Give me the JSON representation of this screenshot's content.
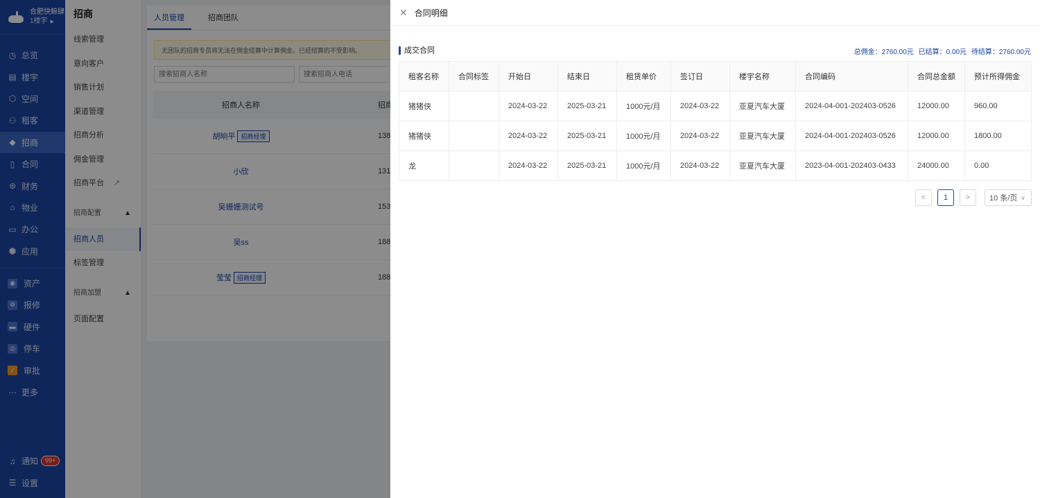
{
  "nav": {
    "brand_name": "合肥快鲸肆",
    "brand_sub": "1楼宇",
    "items": [
      {
        "label": "总览",
        "icon": "dashboard-icon"
      },
      {
        "label": "楼宇",
        "icon": "building-icon"
      },
      {
        "label": "空间",
        "icon": "cube-icon"
      },
      {
        "label": "租客",
        "icon": "tenant-icon"
      },
      {
        "label": "招商",
        "icon": "tag-icon"
      },
      {
        "label": "合同",
        "icon": "document-icon"
      },
      {
        "label": "财务",
        "icon": "finance-icon"
      },
      {
        "label": "物业",
        "icon": "home-icon"
      },
      {
        "label": "办公",
        "icon": "monitor-icon"
      },
      {
        "label": "应用",
        "icon": "app-icon"
      }
    ],
    "ext_items": [
      {
        "label": "资产",
        "icon": "asset-icon"
      },
      {
        "label": "报修",
        "icon": "repair-icon"
      },
      {
        "label": "硬件",
        "icon": "hardware-icon"
      },
      {
        "label": "停车",
        "icon": "parking-icon"
      },
      {
        "label": "审批",
        "icon": "approval-icon"
      },
      {
        "label": "更多",
        "icon": "more-icon"
      }
    ],
    "notify_label": "通知",
    "notify_count": "99+",
    "settings_label": "设置"
  },
  "submenu": {
    "title": "招商",
    "items": [
      "线索管理",
      "意向客户",
      "销售计划",
      "渠道管理",
      "招商分析",
      "佣金管理",
      "招商平台"
    ],
    "group1": "招商配置",
    "group1_items": [
      "招商人员",
      "标签管理"
    ],
    "group2": "招商加盟",
    "group2_items": [
      "页面配置"
    ]
  },
  "main": {
    "tabs": [
      "人员管理",
      "招商团队"
    ],
    "notice": "无团队的招商专员将无法在佣金结算中计算佣金。已经结算的不受影响。",
    "search_name_placeholder": "搜索招商人名称",
    "search_phone_placeholder": "搜索招商人电话",
    "col_name": "招商人名称",
    "col_phone": "招商",
    "rows": [
      {
        "name": "胡晌平",
        "tag": "招商经理",
        "phone": "138"
      },
      {
        "name": "小欣",
        "tag": "",
        "phone": "131"
      },
      {
        "name": "吴姗姗测试号",
        "tag": "",
        "phone": "153"
      },
      {
        "name": "吴ss",
        "tag": "",
        "phone": "188"
      },
      {
        "name": "莹莹",
        "tag": "招商经理",
        "phone": "188"
      }
    ]
  },
  "drawer": {
    "title": "合同明细",
    "section_title": "成交合同",
    "summary": {
      "total": "总佣金：2760.00元",
      "settled": "已结算：0.00元",
      "pending": "待结算：2760.00元"
    },
    "columns": [
      "租客名称",
      "合同标签",
      "开始日",
      "结束日",
      "租赁单价",
      "签订日",
      "楼宇名称",
      "合同编码",
      "合同总金额",
      "预计所得佣金"
    ],
    "rows": [
      [
        "猪猪侠",
        "",
        "2024-03-22",
        "2025-03-21",
        "1000元/月",
        "2024-03-22",
        "亚夏汽车大厦",
        "2024-04-001-202403-0526",
        "12000.00",
        "960.00"
      ],
      [
        "猪猪侠",
        "",
        "2024-03-22",
        "2025-03-21",
        "1000元/月",
        "2024-03-22",
        "亚夏汽车大厦",
        "2024-04-001-202403-0526",
        "12000.00",
        "1800.00"
      ],
      [
        "龙",
        "",
        "2024-03-22",
        "2025-03-21",
        "1000元/月",
        "2024-03-22",
        "亚夏汽车大厦",
        "2023-04-001-202403-0433",
        "24000.00",
        "0.00"
      ]
    ],
    "pager": {
      "prev": "<",
      "current": "1",
      "next": ">",
      "page_size": "10 条/页"
    }
  },
  "colors": {
    "primary": "#1d46a6",
    "nav_bg": "#1d46a6",
    "badge": "#e0322c"
  }
}
